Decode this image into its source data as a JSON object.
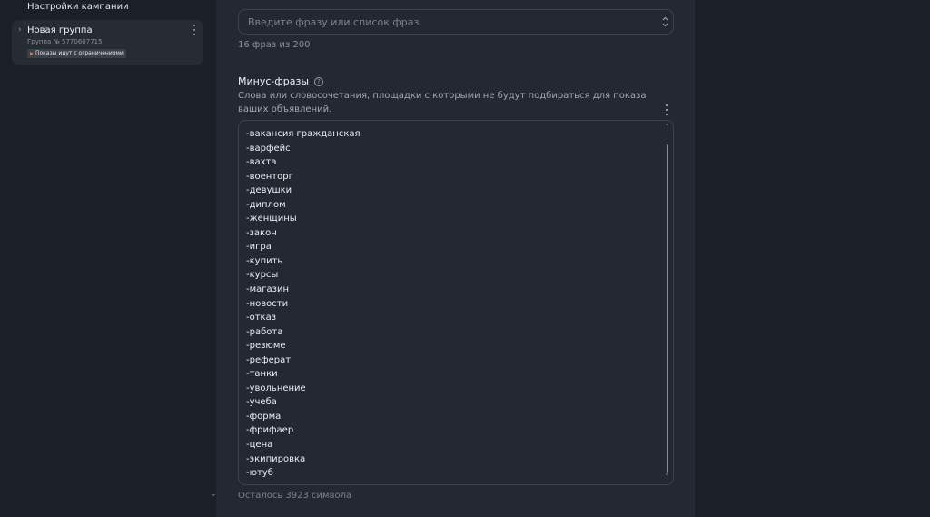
{
  "sidebar": {
    "campaign_settings": "Настройки кампании",
    "group": {
      "title": "Новая группа",
      "subtitle": "Группа № 5770607715",
      "badge": "Показы идут с ограничениями"
    }
  },
  "phrases": {
    "placeholder": "Введите фразу или список фраз",
    "counter": "16 фраз из 200"
  },
  "minus_phrases": {
    "title": "Минус-фразы",
    "description": "Слова или словосочетания, площадки с которыми не будут подбираться для показа ваших объявлений.",
    "items": [
      "-вакансия гражданская",
      "-варфейс",
      "-вахта",
      "-военторг",
      "-девушки",
      "-диплом",
      "-женщины",
      "-закон",
      "-игра",
      "-купить",
      "-курсы",
      "-магазин",
      "-новости",
      "-отказ",
      "-работа",
      "-резюме",
      "-реферат",
      "-танки",
      "-увольнение",
      "-учеба",
      "-форма",
      "-фрифаер",
      "-цена",
      "-экипировка",
      "-ютуб"
    ],
    "remaining": "Осталось 3923 символа"
  }
}
